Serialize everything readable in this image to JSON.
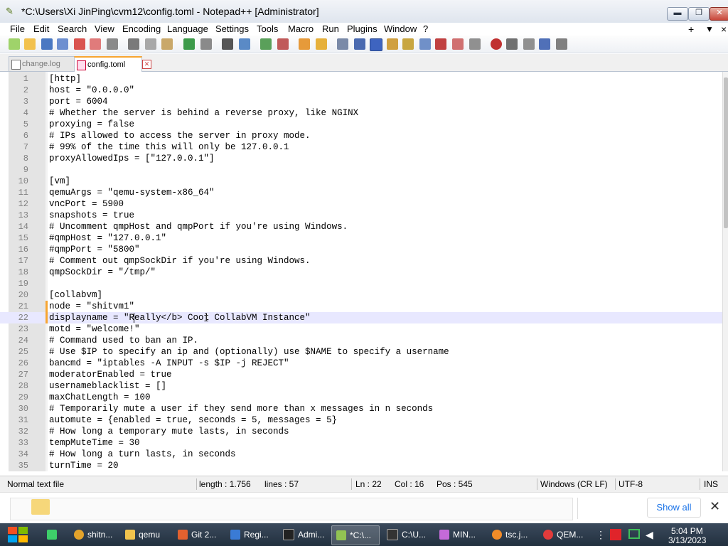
{
  "window": {
    "title": "*C:\\Users\\Xi JinPing\\cvm12\\config.toml - Notepad++ [Administrator]"
  },
  "menu": {
    "items": [
      "File",
      "Edit",
      "Search",
      "View",
      "Encoding",
      "Language",
      "Settings",
      "Tools",
      "Macro",
      "Run",
      "Plugins",
      "Window",
      "?"
    ],
    "right_plus": "+",
    "right_down": "▼",
    "right_x": "×"
  },
  "tabs": [
    {
      "label": "change.log",
      "active": false
    },
    {
      "label": "config.toml",
      "active": true
    }
  ],
  "editor": {
    "lines": [
      {
        "n": "1",
        "text": "[http]"
      },
      {
        "n": "2",
        "text": "host = \"0.0.0.0\""
      },
      {
        "n": "3",
        "text": "port = 6004"
      },
      {
        "n": "4",
        "text": "# Whether the server is behind a reverse proxy, like NGINX"
      },
      {
        "n": "5",
        "text": "proxying = false"
      },
      {
        "n": "6",
        "text": "# IPs allowed to access the server in proxy mode."
      },
      {
        "n": "7",
        "text": "# 99% of the time this will only be 127.0.0.1"
      },
      {
        "n": "8",
        "text": "proxyAllowedIps = [\"127.0.0.1\"]"
      },
      {
        "n": "9",
        "text": ""
      },
      {
        "n": "10",
        "text": "[vm]"
      },
      {
        "n": "11",
        "text": "qemuArgs = \"qemu-system-x86_64\""
      },
      {
        "n": "12",
        "text": "vncPort = 5900"
      },
      {
        "n": "13",
        "text": "snapshots = true"
      },
      {
        "n": "14",
        "text": "# Uncomment qmpHost and qmpPort if you're using Windows."
      },
      {
        "n": "15",
        "text": "#qmpHost = \"127.0.0.1\""
      },
      {
        "n": "16",
        "text": "#qmpPort = \"5800\""
      },
      {
        "n": "17",
        "text": "# Comment out qmpSockDir if you're using Windows."
      },
      {
        "n": "18",
        "text": "qmpSockDir = \"/tmp/\""
      },
      {
        "n": "19",
        "text": ""
      },
      {
        "n": "20",
        "text": "[collabvm]"
      },
      {
        "n": "21",
        "text": "node = \"shitvm1\""
      },
      {
        "n": "22",
        "text": "displayname = \"Really</b> Cool CollabVM Instance\""
      },
      {
        "n": "23",
        "text": "motd = \"welcome!\""
      },
      {
        "n": "24",
        "text": "# Command used to ban an IP."
      },
      {
        "n": "25",
        "text": "# Use $IP to specify an ip and (optionally) use $NAME to specify a username"
      },
      {
        "n": "26",
        "text": "bancmd = \"iptables -A INPUT -s $IP -j REJECT\""
      },
      {
        "n": "27",
        "text": "moderatorEnabled = true"
      },
      {
        "n": "28",
        "text": "usernameblacklist = []"
      },
      {
        "n": "29",
        "text": "maxChatLength = 100"
      },
      {
        "n": "30",
        "text": "# Temporarily mute a user if they send more than x messages in n seconds"
      },
      {
        "n": "31",
        "text": "automute = {enabled = true, seconds = 5, messages = 5}"
      },
      {
        "n": "32",
        "text": "# How long a temporary mute lasts, in seconds"
      },
      {
        "n": "33",
        "text": "tempMuteTime = 30"
      },
      {
        "n": "34",
        "text": "# How long a turn lasts, in seconds"
      },
      {
        "n": "35",
        "text": "turnTime = 20"
      }
    ],
    "current_line": "22"
  },
  "status": {
    "file_type": "Normal text file",
    "length": "length : 1.756",
    "lines": "lines : 57",
    "ln": "Ln : 22",
    "col": "Col : 16",
    "pos": "Pos : 545",
    "eol": "Windows (CR LF)",
    "encoding": "UTF-8",
    "mode": "INS"
  },
  "notification": {
    "show_all": "Show all"
  },
  "taskbar": {
    "items": [
      {
        "label": "",
        "color": "#3ecf6a"
      },
      {
        "label": "shitn...",
        "color": "#e3a32b"
      },
      {
        "label": "qemu",
        "color": "#f1c34d"
      },
      {
        "label": "Git 2...",
        "color": "#e2612f"
      },
      {
        "label": "Regi...",
        "color": "#3a7bd5"
      },
      {
        "label": "Admi...",
        "color": "#222222"
      },
      {
        "label": "*C:\\...",
        "color": "#92c353"
      },
      {
        "label": "C:\\U...",
        "color": "#333333"
      },
      {
        "label": "MIN...",
        "color": "#c46ad8"
      },
      {
        "label": "tsc.j...",
        "color": "#f28c28"
      },
      {
        "label": "QEM...",
        "color": "#e23b3b"
      }
    ],
    "clock_time": "5:04 PM",
    "clock_date": "3/13/2023"
  },
  "colors": {
    "accent": "#f7a531",
    "current_line": "#e8e8ff",
    "link": "#1a73e8"
  }
}
